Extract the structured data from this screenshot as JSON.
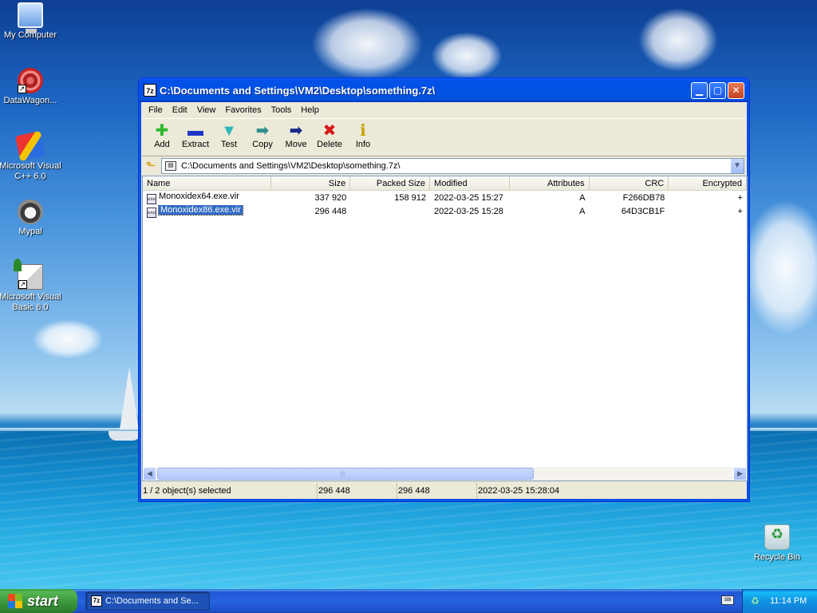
{
  "desktop": {
    "icons": [
      {
        "label": "My Computer",
        "icon": "my-computer-icon"
      },
      {
        "label": "DataWagon...",
        "icon": "datawagon-icon"
      },
      {
        "label": "Microsoft Visual C++ 6.0",
        "icon": "visual-cpp-icon"
      },
      {
        "label": "Mypal",
        "icon": "mypal-icon"
      },
      {
        "label": "Microsoft Visual Basic 6.0",
        "icon": "visual-basic-icon"
      },
      {
        "label": "Recycle Bin",
        "icon": "recycle-bin-icon"
      }
    ]
  },
  "window": {
    "app_icon": "7z",
    "title": "C:\\Documents and Settings\\VM2\\Desktop\\something.7z\\",
    "menu": [
      "File",
      "Edit",
      "View",
      "Favorites",
      "Tools",
      "Help"
    ],
    "toolbar": [
      {
        "label": "Add",
        "glyph": "✚",
        "color": "#2bb82b"
      },
      {
        "label": "Extract",
        "glyph": "▬",
        "color": "#1e36c8"
      },
      {
        "label": "Test",
        "glyph": "▼",
        "color": "#2fb8b8"
      },
      {
        "label": "Copy",
        "glyph": "➡",
        "color": "#2f8f8f"
      },
      {
        "label": "Move",
        "glyph": "➡",
        "color": "#1a2a8a"
      },
      {
        "label": "Delete",
        "glyph": "✖",
        "color": "#d81818"
      },
      {
        "label": "Info",
        "glyph": "ℹ",
        "color": "#c8a000"
      }
    ],
    "address": "C:\\Documents and Settings\\VM2\\Desktop\\something.7z\\",
    "columns": {
      "name": "Name",
      "size": "Size",
      "packed": "Packed Size",
      "modified": "Modified",
      "attributes": "Attributes",
      "crc": "CRC",
      "encrypted": "Encrypted"
    },
    "files": [
      {
        "name": "Monoxidex64.exe.vir",
        "size": "337 920",
        "packed": "158 912",
        "modified": "2022-03-25 15:27",
        "attributes": "A",
        "crc": "F266DB78",
        "encrypted": "+"
      },
      {
        "name": "Monoxidex86.exe.vir",
        "size": "296 448",
        "packed": "",
        "modified": "2022-03-25 15:28",
        "attributes": "A",
        "crc": "64D3CB1F",
        "encrypted": "+"
      }
    ],
    "status": {
      "selection": "1 / 2 object(s) selected",
      "size": "296 448",
      "packed": "296 448",
      "modified": "2022-03-25 15:28:04"
    }
  },
  "taskbar": {
    "start_label": "start",
    "task_label": "C:\\Documents and Se...",
    "clock": "11:14 PM"
  },
  "colors": {
    "title_blue": "#0151e6",
    "selection": "#316ac5",
    "start_green": "#3a933a"
  }
}
